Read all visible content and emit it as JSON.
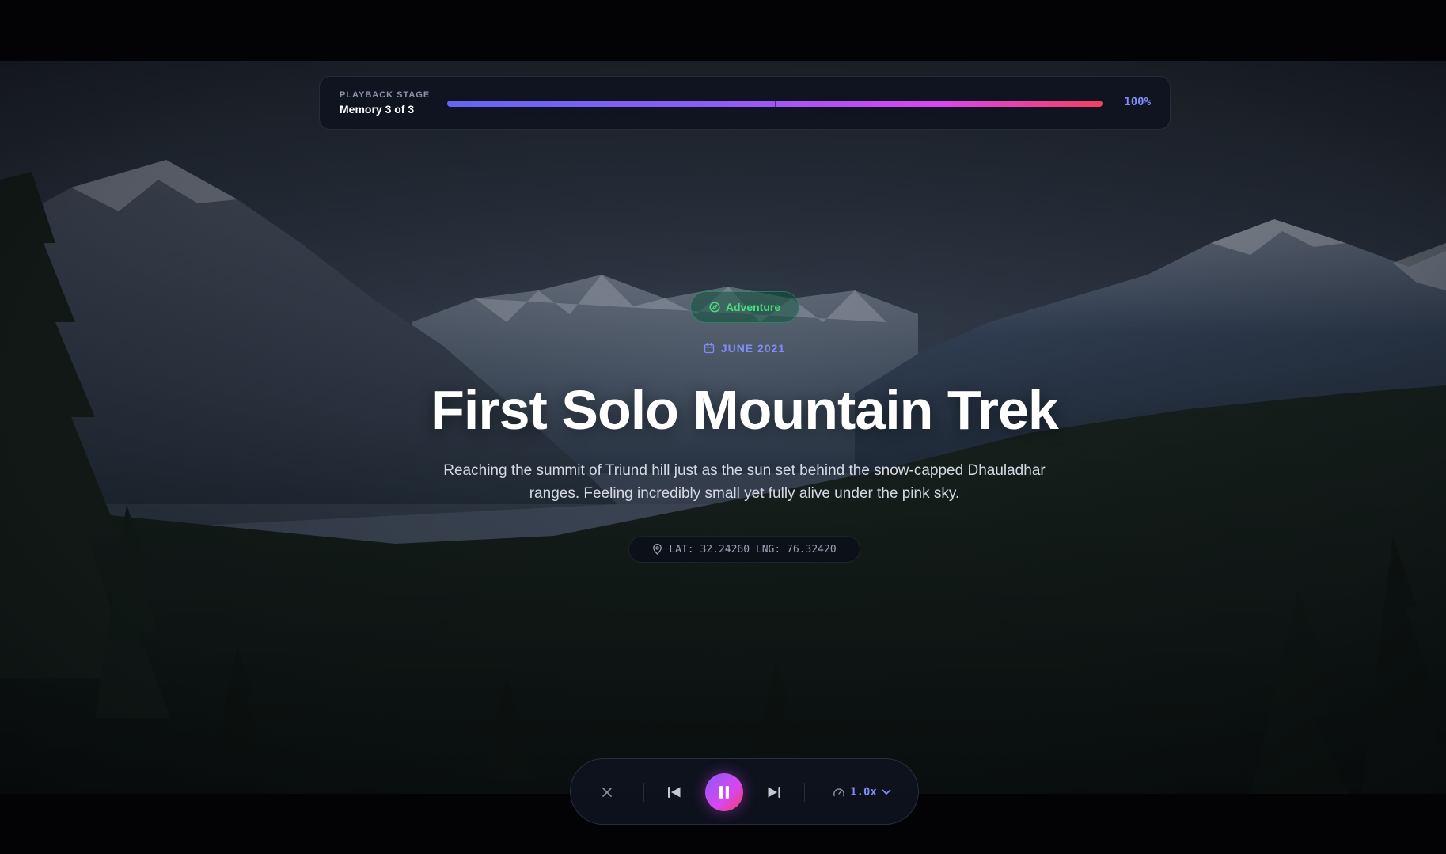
{
  "playback": {
    "stage_label": "PLAYBACK STAGE",
    "stage_value": "Memory 3 of 3",
    "percent_label": "100%",
    "progress": 1.0,
    "segments": 2
  },
  "memory": {
    "category": "Adventure",
    "category_icon": "compass-icon",
    "date": "JUNE 2021",
    "date_icon": "calendar-icon",
    "title": "First Solo Mountain Trek",
    "description": "Reaching the summit of Triund hill just as the sun set behind the snow-capped Dhauladhar ranges. Feeling incredibly small yet fully alive under the pink sky.",
    "coordinates": "LAT: 32.24260 LNG: 76.32420",
    "coordinates_icon": "map-pin-icon"
  },
  "controls": {
    "close_icon": "close-icon",
    "prev_icon": "skip-back-icon",
    "play_icon": "pause-icon",
    "next_icon": "skip-forward-icon",
    "speed_icon": "gauge-icon",
    "speed_value": "1.0x"
  },
  "colors": {
    "accent": "#818cf8",
    "category": "#4ade80",
    "progress_start": "#6366f1",
    "progress_end": "#f43f5e"
  }
}
